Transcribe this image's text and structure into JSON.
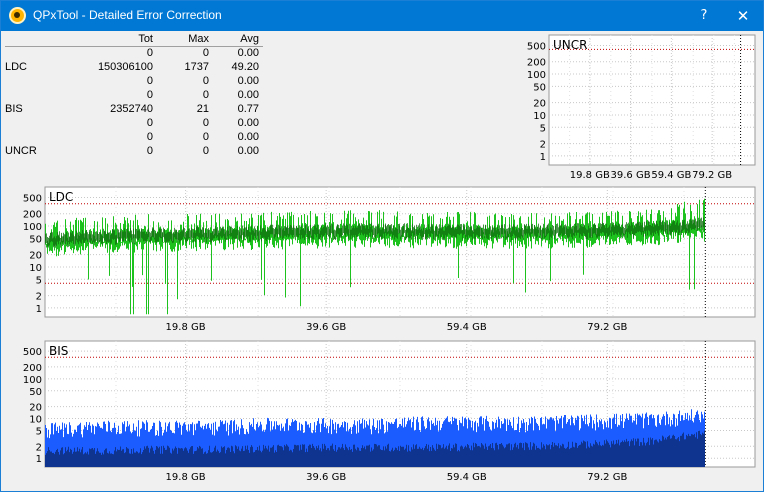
{
  "window": {
    "title": "QPxTool - Detailed Error Correction",
    "help_label": "?",
    "close_label": "✕",
    "icon": "qpxtool-app-icon"
  },
  "stats": {
    "headers": [
      "",
      "Tot",
      "Max",
      "Avg"
    ],
    "rows": [
      [
        "",
        "0",
        "0",
        "0.00"
      ],
      [
        "LDC",
        "150306100",
        "1737",
        "49.20"
      ],
      [
        "",
        "0",
        "0",
        "0.00"
      ],
      [
        "",
        "0",
        "0",
        "0.00"
      ],
      [
        "BIS",
        "2352740",
        "21",
        "0.77"
      ],
      [
        "",
        "0",
        "0",
        "0.00"
      ],
      [
        "",
        "0",
        "0",
        "0.00"
      ],
      [
        "UNCR",
        "0",
        "0",
        "0.00"
      ]
    ]
  },
  "chart_data": [
    {
      "type": "area",
      "title": "UNCR",
      "yscale": "log",
      "yticks": [
        "500",
        "200",
        "100",
        "50",
        "20",
        "10",
        "5",
        "2",
        "1"
      ],
      "ytick_values": [
        500,
        200,
        100,
        50,
        20,
        10,
        5,
        2,
        1
      ],
      "xticks": [
        "19.8 GB",
        "39.6 GB",
        "59.4 GB",
        "79.2 GB"
      ],
      "xtick_values": [
        19.8,
        39.6,
        59.4,
        79.2
      ],
      "xlim": [
        0,
        100
      ],
      "data_end": 93,
      "threshold": 400,
      "series": [
        {
          "values": [
            0
          ]
        }
      ],
      "grid": true
    },
    {
      "type": "area",
      "title": "LDC",
      "yscale": "log",
      "yticks": [
        "500",
        "200",
        "100",
        "50",
        "20",
        "10",
        "5",
        "2",
        "1"
      ],
      "ytick_values": [
        500,
        200,
        100,
        50,
        20,
        10,
        5,
        2,
        1
      ],
      "xticks": [
        "19.8 GB",
        "39.6 GB",
        "59.4 GB",
        "79.2 GB"
      ],
      "xtick_values": [
        19.8,
        39.6,
        59.4,
        79.2
      ],
      "xlim": [
        0,
        100
      ],
      "data_end": 93,
      "threshold": 350,
      "threshold_low": 4,
      "series": [
        {
          "values": [
            50,
            60,
            65,
            70,
            75,
            80,
            85,
            80,
            78,
            80,
            85,
            95,
            115
          ]
        },
        {
          "values": [
            150,
            180,
            200,
            210,
            220,
            240,
            250,
            230,
            220,
            210,
            230,
            260,
            500
          ]
        }
      ],
      "colors": {
        "fill": "#1ec21e",
        "line": "#0f6e0f",
        "threshold": "#c00000"
      },
      "grid": true
    },
    {
      "type": "area",
      "title": "BIS",
      "yscale": "log",
      "yticks": [
        "500",
        "200",
        "100",
        "50",
        "20",
        "10",
        "5",
        "2",
        "1"
      ],
      "ytick_values": [
        500,
        200,
        100,
        50,
        20,
        10,
        5,
        2,
        1
      ],
      "xticks": [
        "19.8 GB",
        "39.6 GB",
        "59.4 GB",
        "79.2 GB"
      ],
      "xtick_values": [
        19.8,
        39.6,
        59.4,
        79.2
      ],
      "xlim": [
        0,
        100
      ],
      "data_end": 93,
      "threshold": 350,
      "series": [
        {
          "values": [
            1.5,
            1.5,
            1.6,
            1.6,
            1.7,
            1.8,
            1.8,
            1.8,
            1.9,
            2.0,
            2.2,
            2.6,
            4.0
          ]
        },
        {
          "values": [
            6,
            7,
            7,
            7,
            8,
            8,
            8,
            9,
            9,
            9,
            10,
            11,
            14
          ]
        }
      ],
      "colors": {
        "fill": "#1a5cff",
        "dark": "#0f3490",
        "threshold": "#c00000"
      },
      "grid": true
    }
  ]
}
